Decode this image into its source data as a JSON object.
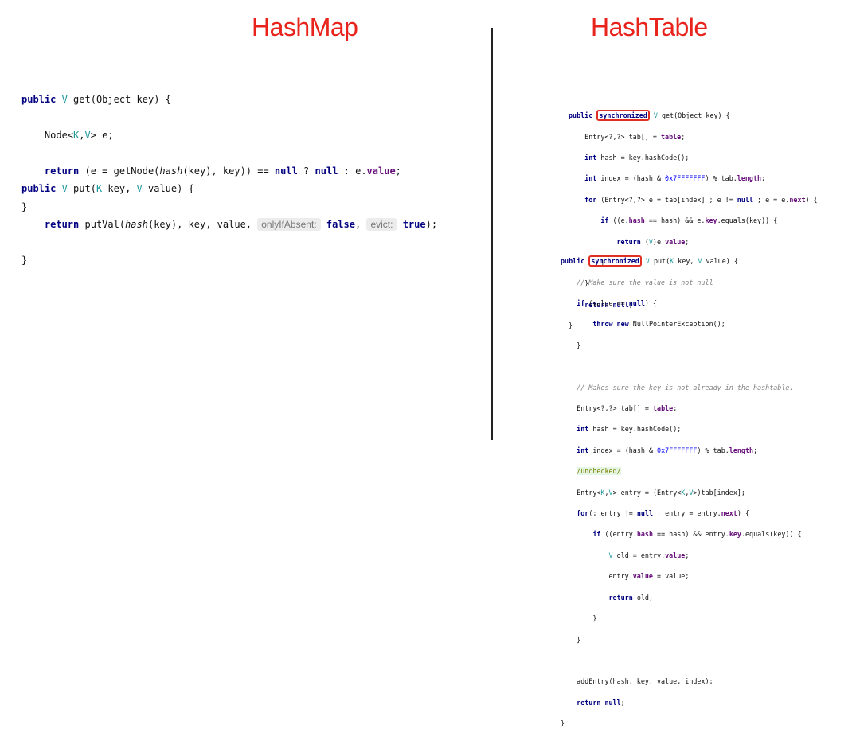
{
  "titles": {
    "left": "HashMap",
    "right": "HashTable"
  },
  "hints": {
    "only_if_absent": "onlyIfAbsent:",
    "evict": "evict:"
  },
  "code_tokens": {
    "public": "public",
    "synchronized": "synchronized",
    "return": "return",
    "null": "null",
    "int": "int",
    "for": "for",
    "if": "if",
    "throw": "throw",
    "new": "new",
    "false": "false",
    "true": "true"
  },
  "hashmap": {
    "get": [
      "public V get(Object key) {",
      "Node<K,V> e;",
      "return (e = getNode(hash(key), key)) == null ? null : e.value;",
      "}"
    ],
    "put": [
      "public V put(K key, V value) {",
      "return putVal(hash(key), key, value, onlyIfAbsent: false, evict: true);",
      "}"
    ]
  },
  "hashtable": {
    "get_comment": "",
    "put_comment_1": "// Make sure the value is not null",
    "put_comment_2": "// Makes sure the key is not already in the hashtable.",
    "annotation": "/unchecked/"
  }
}
